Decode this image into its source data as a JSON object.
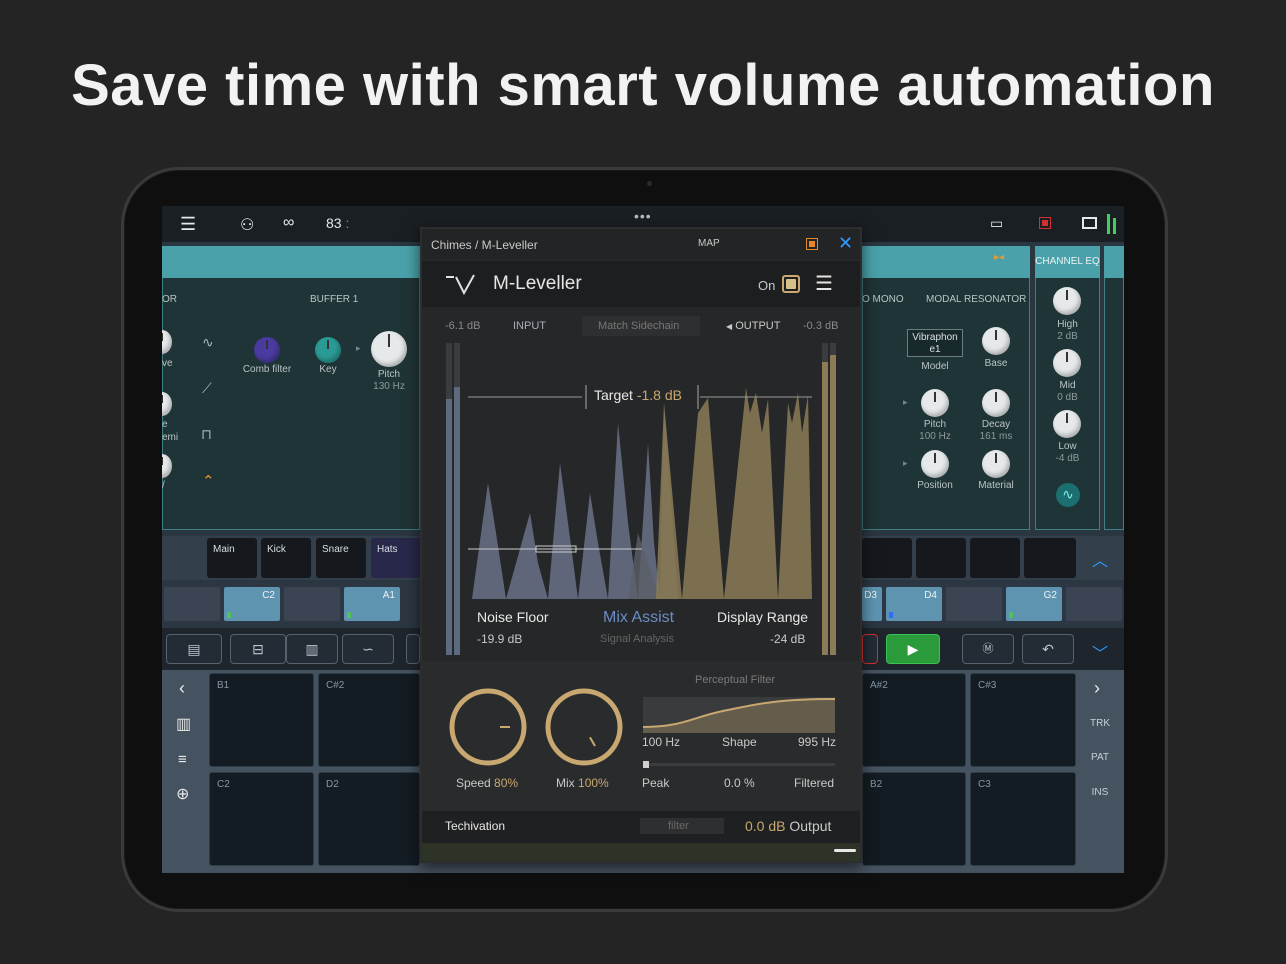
{
  "headline": "Save time with smart volume automation",
  "topbar": {
    "tempo": "83",
    "tempo_suffix": ":"
  },
  "left_panel": {
    "section_a": "OR",
    "section_b": "BUFFER 1",
    "knobs": [
      {
        "label": "Comb filter",
        "value": ""
      },
      {
        "label": "Key",
        "value": ""
      },
      {
        "label": "Pitch",
        "value": "130 Hz"
      }
    ],
    "partial_labels": [
      "ve",
      "e",
      "emi",
      "/"
    ]
  },
  "right_panel": {
    "section_a": "O MONO",
    "section_b": "MODAL RESONATOR",
    "model_box": "Vibraphon e1",
    "model_label": "Model",
    "knobs": [
      {
        "label": "Base",
        "value": ""
      },
      {
        "label": "Pitch",
        "value": "100 Hz"
      },
      {
        "label": "Decay",
        "value": "161 ms"
      },
      {
        "label": "Position",
        "value": ""
      },
      {
        "label": "Material",
        "value": ""
      }
    ]
  },
  "channel_eq": {
    "title": "CHANNEL EQ",
    "bands": [
      {
        "label": "High",
        "value": "2 dB"
      },
      {
        "label": "Mid",
        "value": "0 dB"
      },
      {
        "label": "Low",
        "value": "-4 dB"
      }
    ]
  },
  "tracks": [
    "Main",
    "Kick",
    "Snare",
    "Hats"
  ],
  "clips_left": [
    "",
    "C2",
    "",
    "A1"
  ],
  "clips_right": [
    "D3",
    "D4",
    "",
    "G2",
    ""
  ],
  "pads_left": [
    "B1",
    "C#2",
    "C2",
    "D2"
  ],
  "pads_right": [
    "A#2",
    "C#3",
    "B2",
    "C3"
  ],
  "side_nav": {
    "trk": "TRK",
    "pat": "PAT",
    "ins": "INS"
  },
  "plugin": {
    "breadcrumb": "Chimes / M-Leveller",
    "map": "MAP",
    "name": "M-Leveller",
    "on": "On",
    "input_db": "-6.1 dB",
    "input": "INPUT",
    "match_sidechain": "Match Sidechain",
    "output": "OUTPUT",
    "output_db": "-0.3 dB",
    "target_label": "Target",
    "target_value": "-1.8 dB",
    "noise_floor": "Noise Floor",
    "noise_floor_value": "-19.9 dB",
    "mix_assist": "Mix Assist",
    "signal_analysis": "Signal Analysis",
    "display_range": "Display Range",
    "display_range_value": "-24 dB",
    "speed": "Speed",
    "speed_value": "80%",
    "mix": "Mix",
    "mix_value": "100%",
    "speed_level": 0.8,
    "mix_level": 1.0,
    "perceptual_filter": "Perceptual Filter",
    "low_freq": "100 Hz",
    "shape": "Shape",
    "high_freq": "995 Hz",
    "peak": "Peak",
    "peak_pct": "0.0 %",
    "filtered": "Filtered",
    "preset": "Techivation",
    "filter_tag": "filter",
    "output_gain": "0.0 dB",
    "output_gain_label": "Output"
  },
  "colors": {
    "accent_gold": "#c8a870",
    "teal": "#4aa1aa",
    "blue": "#2d9cff",
    "record_red": "#d23030",
    "play_green": "#2a9a3a"
  }
}
